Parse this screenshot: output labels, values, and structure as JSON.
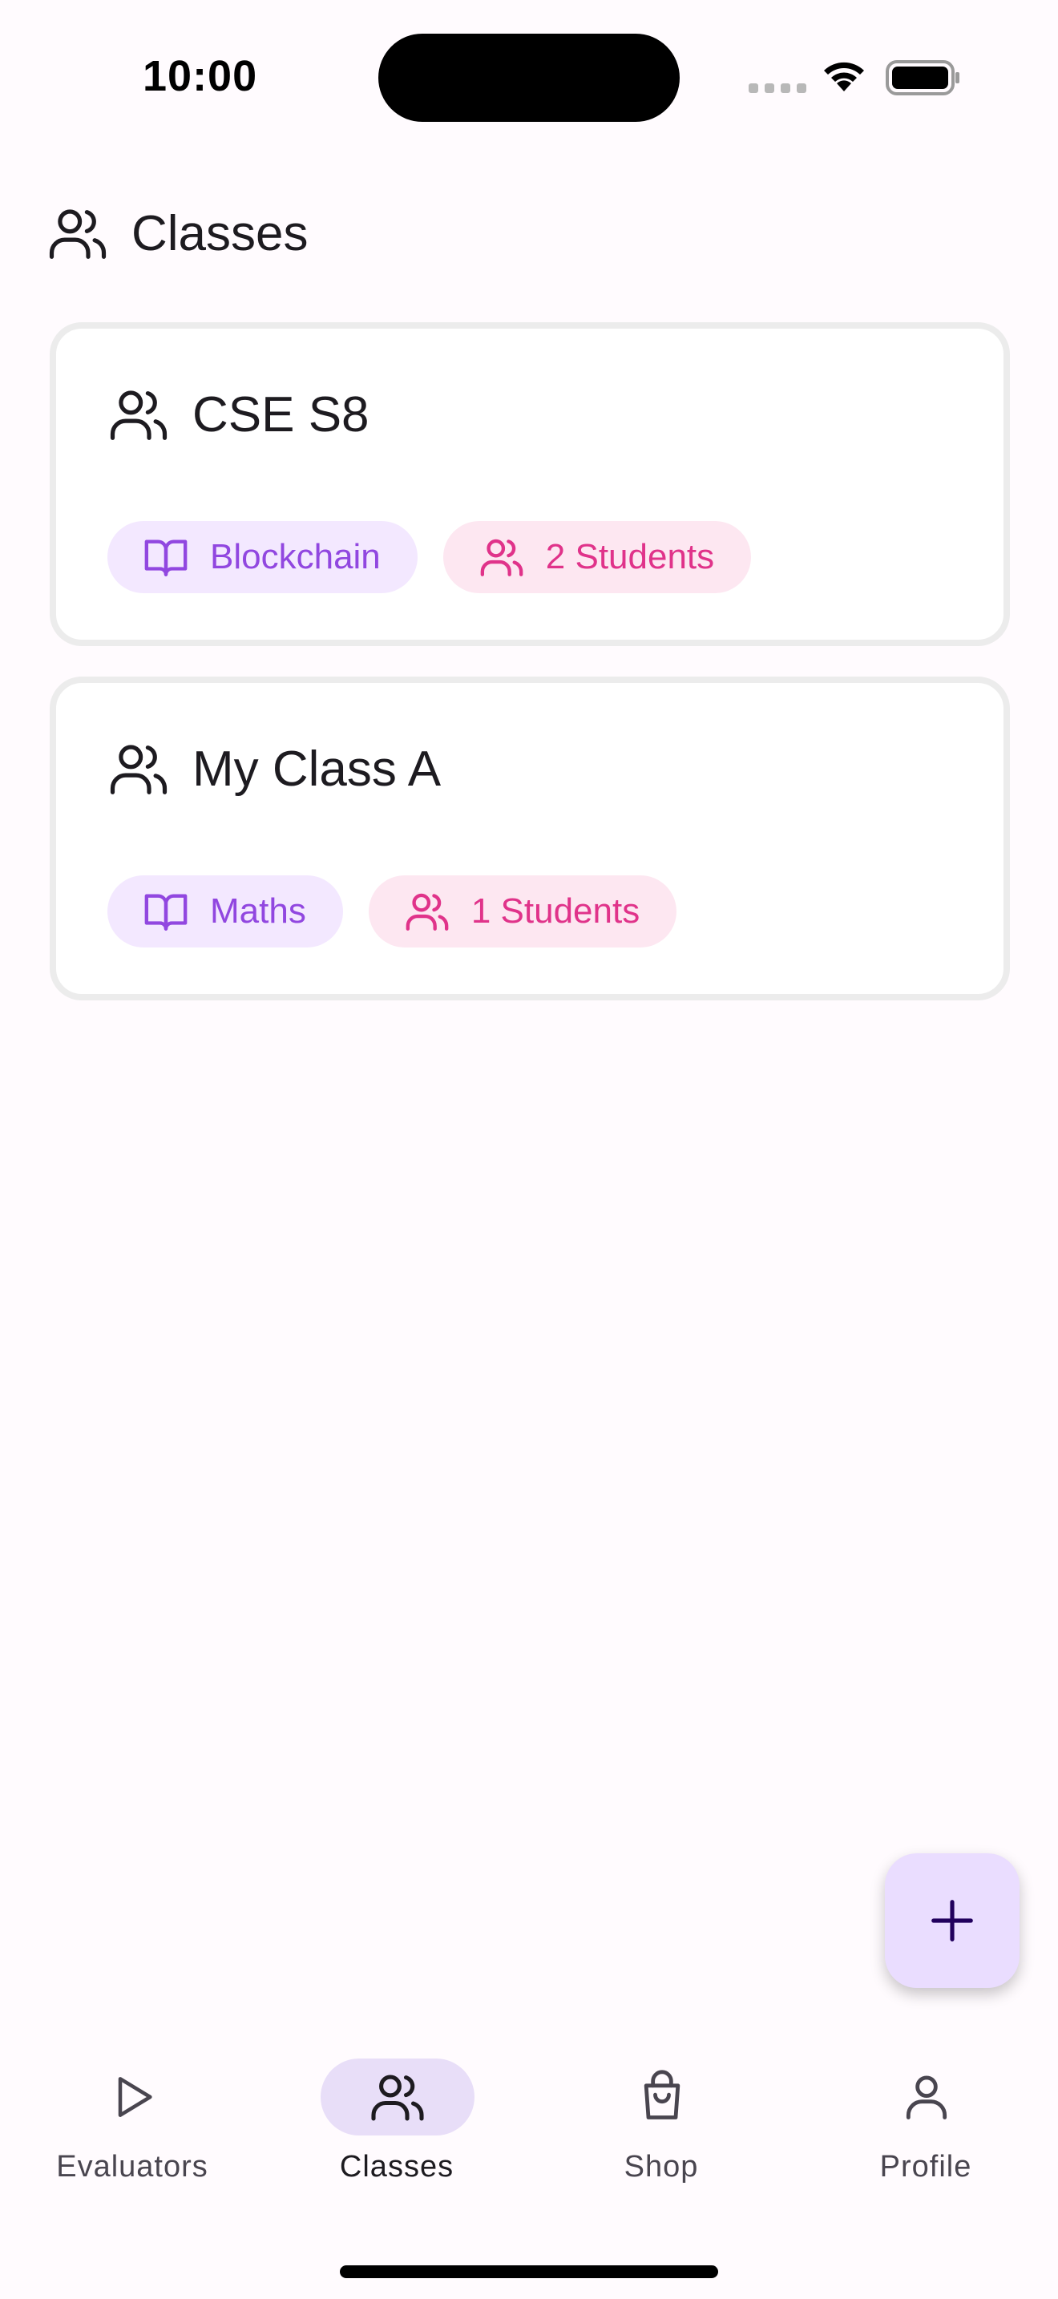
{
  "status_bar": {
    "time": "10:00"
  },
  "header": {
    "title": "Classes",
    "icon": "users-icon"
  },
  "classes": [
    {
      "name": "CSE S8",
      "subject": "Blockchain",
      "students": "2 Students"
    },
    {
      "name": "My Class A",
      "subject": "Maths",
      "students": "1 Students"
    }
  ],
  "fab": {
    "icon": "plus-icon"
  },
  "bottom_nav": {
    "items": [
      {
        "label": "Evaluators",
        "icon": "play-icon",
        "active": false
      },
      {
        "label": "Classes",
        "icon": "users-icon",
        "active": true
      },
      {
        "label": "Shop",
        "icon": "shopping-bag-icon",
        "active": false
      },
      {
        "label": "Profile",
        "icon": "user-icon",
        "active": false
      }
    ]
  },
  "colors": {
    "accent": "#e8def8",
    "fab": "#eaddff",
    "subject_chip_bg": "#f3e8ff",
    "subject_chip_text": "#9147e0",
    "students_chip_bg": "#fde7f1",
    "students_chip_text": "#e0338a"
  }
}
